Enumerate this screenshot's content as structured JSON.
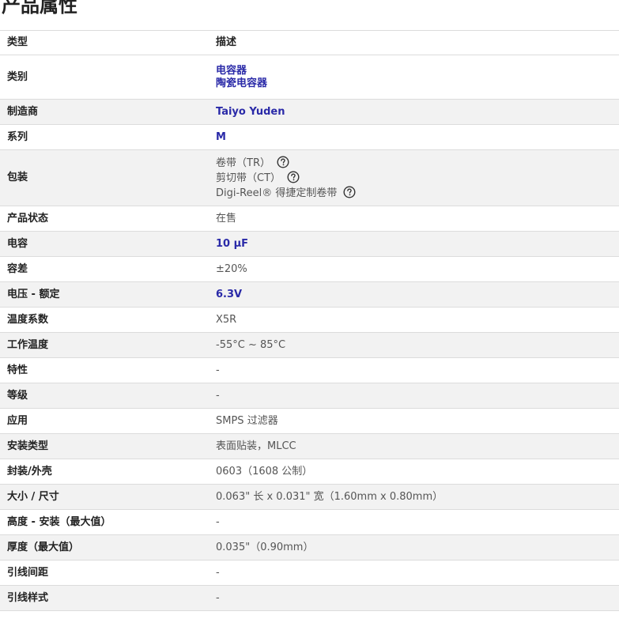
{
  "page": {
    "title": "产品属性"
  },
  "table": {
    "header": {
      "type_label": "类型",
      "desc_label": "描述"
    },
    "category": {
      "label": "类别",
      "values": [
        "电容器",
        "陶瓷电容器"
      ]
    },
    "manufacturer": {
      "label": "制造商",
      "value": "Taiyo Yuden"
    },
    "series": {
      "label": "系列",
      "value": "M"
    },
    "packaging": {
      "label": "包装",
      "options": [
        "卷带（TR）",
        "剪切带（CT）",
        "Digi-Reel® 得捷定制卷带"
      ]
    },
    "product_status": {
      "label": "产品状态",
      "value": "在售"
    },
    "capacitance": {
      "label": "电容",
      "value": "10 µF"
    },
    "tolerance": {
      "label": "容差",
      "value": "±20%"
    },
    "voltage_rated": {
      "label": "电压 - 额定",
      "value": "6.3V"
    },
    "temp_coefficient": {
      "label": "温度系数",
      "value": "X5R"
    },
    "operating_temp": {
      "label": "工作温度",
      "value": "-55°C ~ 85°C"
    },
    "features": {
      "label": "特性",
      "value": "-"
    },
    "ratings": {
      "label": "等级",
      "value": "-"
    },
    "applications": {
      "label": "应用",
      "value": "SMPS 过滤器"
    },
    "mounting_type": {
      "label": "安装类型",
      "value": "表面贴装，MLCC"
    },
    "package_case": {
      "label": "封装/外壳",
      "value": "0603（1608 公制）"
    },
    "size_dimension": {
      "label": "大小 / 尺寸",
      "value": "0.063\" 长 x 0.031\" 宽（1.60mm x 0.80mm）"
    },
    "height_seated": {
      "label": "高度 - 安装（最大值）",
      "value": "-"
    },
    "thickness_max": {
      "label": "厚度（最大值）",
      "value": "0.035\"（0.90mm）"
    },
    "lead_spacing": {
      "label": "引线间距",
      "value": "-"
    },
    "lead_style": {
      "label": "引线样式",
      "value": "-"
    }
  },
  "colors": {
    "link": "#2a2aa8",
    "row_alt": "#f2f2f2",
    "border": "#dcdcdc"
  },
  "icons": {
    "help": "question-circle-icon"
  }
}
